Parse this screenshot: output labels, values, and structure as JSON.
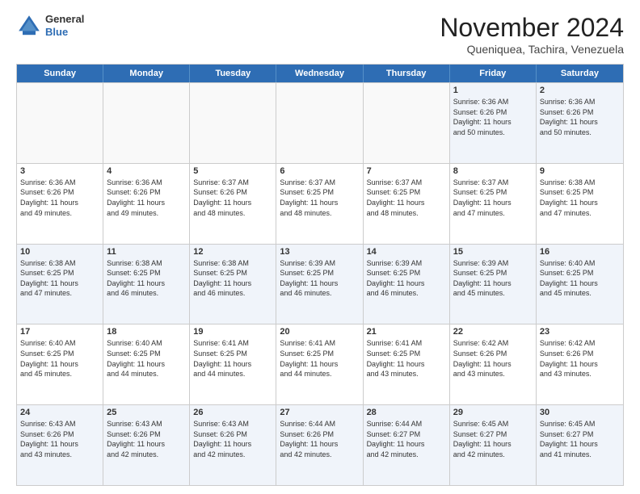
{
  "header": {
    "logo": {
      "general": "General",
      "blue": "Blue"
    },
    "title": "November 2024",
    "subtitle": "Queniquea, Tachira, Venezuela"
  },
  "weekdays": [
    "Sunday",
    "Monday",
    "Tuesday",
    "Wednesday",
    "Thursday",
    "Friday",
    "Saturday"
  ],
  "rows": [
    [
      {
        "day": "",
        "info": ""
      },
      {
        "day": "",
        "info": ""
      },
      {
        "day": "",
        "info": ""
      },
      {
        "day": "",
        "info": ""
      },
      {
        "day": "",
        "info": ""
      },
      {
        "day": "1",
        "info": "Sunrise: 6:36 AM\nSunset: 6:26 PM\nDaylight: 11 hours\nand 50 minutes."
      },
      {
        "day": "2",
        "info": "Sunrise: 6:36 AM\nSunset: 6:26 PM\nDaylight: 11 hours\nand 50 minutes."
      }
    ],
    [
      {
        "day": "3",
        "info": "Sunrise: 6:36 AM\nSunset: 6:26 PM\nDaylight: 11 hours\nand 49 minutes."
      },
      {
        "day": "4",
        "info": "Sunrise: 6:36 AM\nSunset: 6:26 PM\nDaylight: 11 hours\nand 49 minutes."
      },
      {
        "day": "5",
        "info": "Sunrise: 6:37 AM\nSunset: 6:26 PM\nDaylight: 11 hours\nand 48 minutes."
      },
      {
        "day": "6",
        "info": "Sunrise: 6:37 AM\nSunset: 6:25 PM\nDaylight: 11 hours\nand 48 minutes."
      },
      {
        "day": "7",
        "info": "Sunrise: 6:37 AM\nSunset: 6:25 PM\nDaylight: 11 hours\nand 48 minutes."
      },
      {
        "day": "8",
        "info": "Sunrise: 6:37 AM\nSunset: 6:25 PM\nDaylight: 11 hours\nand 47 minutes."
      },
      {
        "day": "9",
        "info": "Sunrise: 6:38 AM\nSunset: 6:25 PM\nDaylight: 11 hours\nand 47 minutes."
      }
    ],
    [
      {
        "day": "10",
        "info": "Sunrise: 6:38 AM\nSunset: 6:25 PM\nDaylight: 11 hours\nand 47 minutes."
      },
      {
        "day": "11",
        "info": "Sunrise: 6:38 AM\nSunset: 6:25 PM\nDaylight: 11 hours\nand 46 minutes."
      },
      {
        "day": "12",
        "info": "Sunrise: 6:38 AM\nSunset: 6:25 PM\nDaylight: 11 hours\nand 46 minutes."
      },
      {
        "day": "13",
        "info": "Sunrise: 6:39 AM\nSunset: 6:25 PM\nDaylight: 11 hours\nand 46 minutes."
      },
      {
        "day": "14",
        "info": "Sunrise: 6:39 AM\nSunset: 6:25 PM\nDaylight: 11 hours\nand 46 minutes."
      },
      {
        "day": "15",
        "info": "Sunrise: 6:39 AM\nSunset: 6:25 PM\nDaylight: 11 hours\nand 45 minutes."
      },
      {
        "day": "16",
        "info": "Sunrise: 6:40 AM\nSunset: 6:25 PM\nDaylight: 11 hours\nand 45 minutes."
      }
    ],
    [
      {
        "day": "17",
        "info": "Sunrise: 6:40 AM\nSunset: 6:25 PM\nDaylight: 11 hours\nand 45 minutes."
      },
      {
        "day": "18",
        "info": "Sunrise: 6:40 AM\nSunset: 6:25 PM\nDaylight: 11 hours\nand 44 minutes."
      },
      {
        "day": "19",
        "info": "Sunrise: 6:41 AM\nSunset: 6:25 PM\nDaylight: 11 hours\nand 44 minutes."
      },
      {
        "day": "20",
        "info": "Sunrise: 6:41 AM\nSunset: 6:25 PM\nDaylight: 11 hours\nand 44 minutes."
      },
      {
        "day": "21",
        "info": "Sunrise: 6:41 AM\nSunset: 6:25 PM\nDaylight: 11 hours\nand 43 minutes."
      },
      {
        "day": "22",
        "info": "Sunrise: 6:42 AM\nSunset: 6:26 PM\nDaylight: 11 hours\nand 43 minutes."
      },
      {
        "day": "23",
        "info": "Sunrise: 6:42 AM\nSunset: 6:26 PM\nDaylight: 11 hours\nand 43 minutes."
      }
    ],
    [
      {
        "day": "24",
        "info": "Sunrise: 6:43 AM\nSunset: 6:26 PM\nDaylight: 11 hours\nand 43 minutes."
      },
      {
        "day": "25",
        "info": "Sunrise: 6:43 AM\nSunset: 6:26 PM\nDaylight: 11 hours\nand 42 minutes."
      },
      {
        "day": "26",
        "info": "Sunrise: 6:43 AM\nSunset: 6:26 PM\nDaylight: 11 hours\nand 42 minutes."
      },
      {
        "day": "27",
        "info": "Sunrise: 6:44 AM\nSunset: 6:26 PM\nDaylight: 11 hours\nand 42 minutes."
      },
      {
        "day": "28",
        "info": "Sunrise: 6:44 AM\nSunset: 6:27 PM\nDaylight: 11 hours\nand 42 minutes."
      },
      {
        "day": "29",
        "info": "Sunrise: 6:45 AM\nSunset: 6:27 PM\nDaylight: 11 hours\nand 42 minutes."
      },
      {
        "day": "30",
        "info": "Sunrise: 6:45 AM\nSunset: 6:27 PM\nDaylight: 11 hours\nand 41 minutes."
      }
    ]
  ],
  "alt_rows": [
    0,
    2,
    4
  ]
}
